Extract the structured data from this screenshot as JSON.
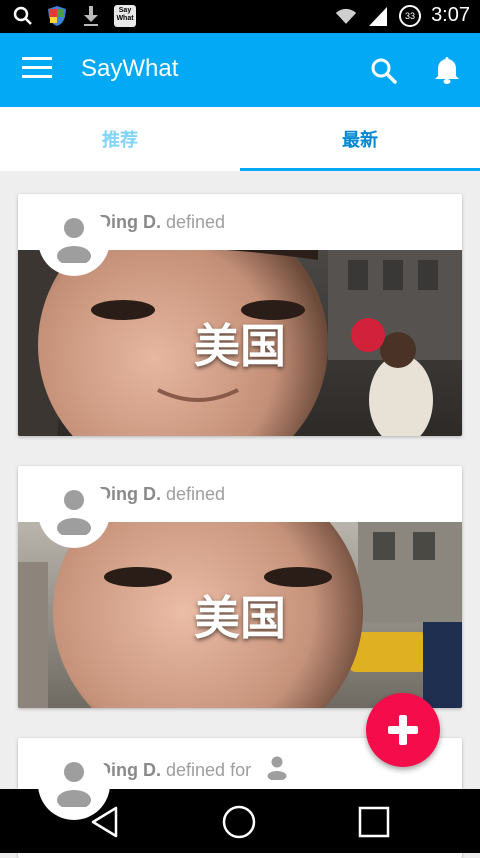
{
  "status_bar": {
    "time": "3:07",
    "battery_level": "33",
    "app_badge": "Say What",
    "icons": [
      "search-icon",
      "shield-icon",
      "download-icon",
      "saywhat-notification-icon",
      "wifi-icon",
      "signal-icon",
      "battery-icon"
    ]
  },
  "app_bar": {
    "title": "SayWhat",
    "background": "#03A9F4",
    "icons": [
      "menu-icon",
      "search-icon",
      "bell-icon"
    ]
  },
  "tabs": [
    {
      "label": "推荐",
      "selected": false
    },
    {
      "label": "最新",
      "selected": true
    }
  ],
  "feed": [
    {
      "author": "Ding D.",
      "action": "defined",
      "caption": "美国"
    },
    {
      "author": "Ding D.",
      "action": "defined",
      "caption": "美国"
    },
    {
      "author": "Ding D.",
      "action": "defined for",
      "caption": ""
    }
  ],
  "fab": {
    "icon": "plus-icon",
    "color": "#F50D4B"
  },
  "nav_bar": {
    "icons": [
      "back-icon",
      "home-icon",
      "recents-icon"
    ]
  }
}
